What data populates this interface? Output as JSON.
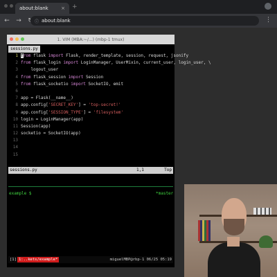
{
  "browser": {
    "tab_title": "about:blank",
    "address": "about:blank",
    "new_tab_symbol": "+",
    "icons": {
      "back": "←",
      "forward": "→",
      "reload": "↻",
      "info": "ⓘ",
      "close": "×",
      "menu": "⋮"
    }
  },
  "terminal": {
    "window_title": "1. VIM (MBA:~/...) (mbp-1 tmux)",
    "buffer_tab": "sessions.py",
    "code_lines": [
      {
        "num": "1",
        "segments": [
          {
            "c": "kw",
            "t": "from"
          },
          {
            "c": "txt",
            "t": " flask "
          },
          {
            "c": "kw",
            "t": "import"
          },
          {
            "c": "txt",
            "t": " Flask, render_template, session, request, jsonify"
          }
        ]
      },
      {
        "num": "2",
        "segments": [
          {
            "c": "kw",
            "t": "from"
          },
          {
            "c": "txt",
            "t": " flask_login "
          },
          {
            "c": "kw",
            "t": "import"
          },
          {
            "c": "txt",
            "t": " LoginManager, UserMixin, current_user, login_user, \\"
          }
        ]
      },
      {
        "num": "3",
        "segments": [
          {
            "c": "txt",
            "t": "    logout_user"
          }
        ]
      },
      {
        "num": "4",
        "segments": [
          {
            "c": "kw",
            "t": "from"
          },
          {
            "c": "txt",
            "t": " flask_session "
          },
          {
            "c": "kw",
            "t": "import"
          },
          {
            "c": "txt",
            "t": " Session"
          }
        ]
      },
      {
        "num": "5",
        "segments": [
          {
            "c": "kw",
            "t": "from"
          },
          {
            "c": "txt",
            "t": " flask_socketio "
          },
          {
            "c": "kw",
            "t": "import"
          },
          {
            "c": "txt",
            "t": " SocketIO, emit"
          }
        ]
      },
      {
        "num": "6",
        "segments": []
      },
      {
        "num": "7",
        "segments": [
          {
            "c": "txt",
            "t": "app = Flask(__name__)"
          }
        ]
      },
      {
        "num": "8",
        "segments": [
          {
            "c": "txt",
            "t": "app.config["
          },
          {
            "c": "str",
            "t": "'SECRET_KEY'"
          },
          {
            "c": "txt",
            "t": "] = "
          },
          {
            "c": "str",
            "t": "'top-secret!'"
          }
        ]
      },
      {
        "num": "9",
        "segments": [
          {
            "c": "txt",
            "t": "app.config["
          },
          {
            "c": "str",
            "t": "'SESSION_TYPE'"
          },
          {
            "c": "txt",
            "t": "] = "
          },
          {
            "c": "str",
            "t": "'filesystem'"
          }
        ]
      },
      {
        "num": "10",
        "segments": [
          {
            "c": "txt",
            "t": "login = LoginManager(app)"
          }
        ]
      },
      {
        "num": "11",
        "segments": [
          {
            "c": "txt",
            "t": "Session(app)"
          }
        ]
      },
      {
        "num": "12",
        "segments": [
          {
            "c": "txt",
            "t": "socketio = SocketIO(app)"
          }
        ]
      },
      {
        "num": "13",
        "segments": []
      },
      {
        "num": "14",
        "segments": []
      },
      {
        "num": "15",
        "segments": []
      }
    ],
    "status": {
      "filename": "sessions.py",
      "position": "1,1",
      "percent": "Top"
    },
    "prompt": "example $",
    "branch": "*master",
    "tmux": {
      "window_num": "[1]",
      "session": "1:..kets/example*",
      "host": "miguel-MBP",
      "right": "miguelMBP@rbp-1 06/25 05:19"
    }
  },
  "webcam": {
    "label": "presenter webcam"
  }
}
